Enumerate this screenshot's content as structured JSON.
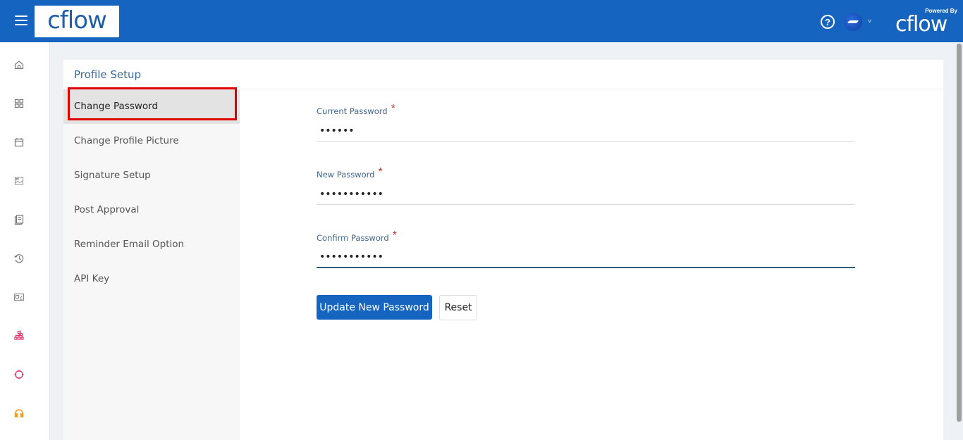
{
  "header": {
    "logo_text": "cflow",
    "powered_by_label": "Powered By",
    "powered_by_logo": "cflow",
    "icons": [
      "menu-icon",
      "help-icon",
      "avatar",
      "chevron-down-icon"
    ],
    "help_glyph": "?",
    "chevron_glyph": "˅",
    "brand_color": "#1565c0"
  },
  "rail": {
    "icons": [
      {
        "name": "home-icon",
        "color": "#777777"
      },
      {
        "name": "dashboard-grid-icon",
        "color": "#777777"
      },
      {
        "name": "calendar-icon",
        "color": "#777777"
      },
      {
        "name": "image-report-icon",
        "color": "#999999"
      },
      {
        "name": "documents-icon",
        "color": "#777777"
      },
      {
        "name": "history-icon",
        "color": "#777777"
      },
      {
        "name": "id-card-icon",
        "color": "#888888"
      },
      {
        "name": "workflow-hierarchy-icon",
        "color": "#e0306a"
      },
      {
        "name": "crosshair-target-icon",
        "color": "#e0306a"
      },
      {
        "name": "headset-support-icon",
        "color": "#f0a020"
      }
    ]
  },
  "page": {
    "title": "Profile Setup",
    "menu": [
      {
        "label": "Change Password",
        "active": true
      },
      {
        "label": "Change Profile Picture",
        "active": false
      },
      {
        "label": "Signature Setup",
        "active": false
      },
      {
        "label": "Post Approval",
        "active": false
      },
      {
        "label": "Reminder Email Option",
        "active": false
      },
      {
        "label": "API Key",
        "active": false
      }
    ],
    "form": {
      "fields": [
        {
          "label": "Current Password",
          "required_mark": "*",
          "value": "••••••",
          "focused": false
        },
        {
          "label": "New Password",
          "required_mark": "*",
          "value": "•••••••••••",
          "focused": false
        },
        {
          "label": "Confirm Password",
          "required_mark": "*",
          "value": "•••••••••••",
          "focused": true
        }
      ],
      "submit_label": "Update New Password",
      "reset_label": "Reset"
    },
    "highlight_color": "#e00000"
  }
}
